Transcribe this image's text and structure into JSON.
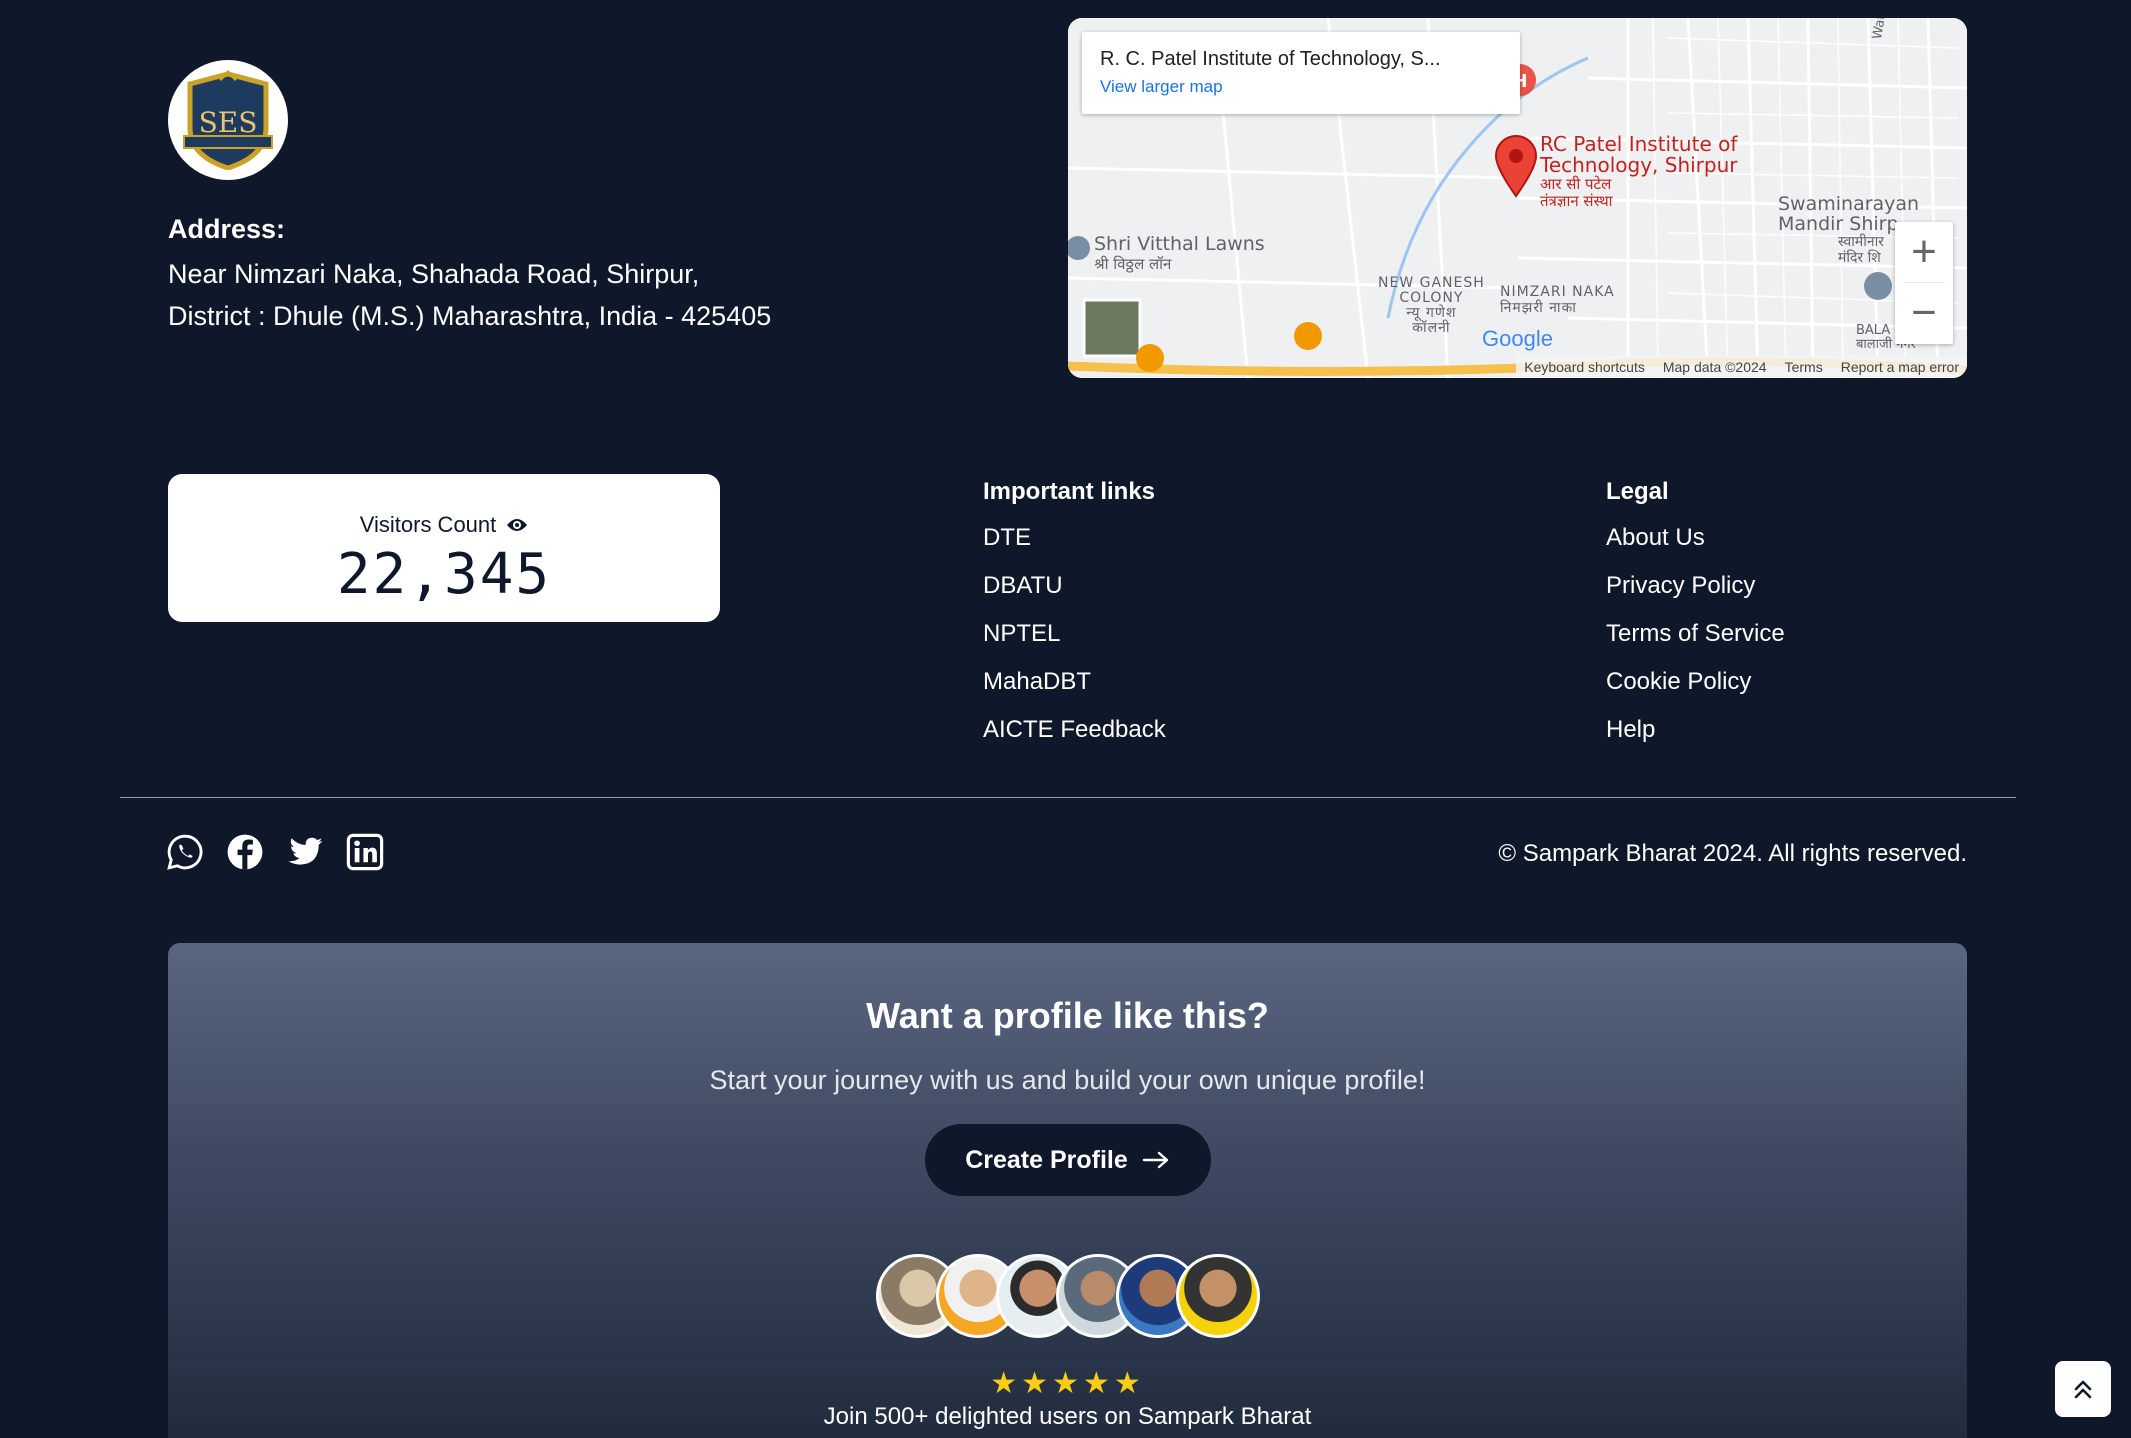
{
  "address": {
    "heading": "Address:",
    "line1": "Near Nimzari Naka, Shahada Road, Shirpur,",
    "line2": "District : Dhule (M.S.) Maharashtra, India - 425405"
  },
  "map": {
    "place_title": "R. C. Patel Institute of Technology, S...",
    "view_larger": "View larger map",
    "pin_label_line1": "RC Patel Institute of",
    "pin_label_line2": "Technology, Shirpur",
    "pin_label_hi1": "आर सी पटेल",
    "pin_label_hi2": "तंत्रज्ञान संस्था",
    "labels": {
      "vitthal": "Shri Vitthal Lawns",
      "vitthal_hi": "श्री विठ्ठल लॉन",
      "ganesh1": "NEW GANESH",
      "ganesh2": "COLONY",
      "ganesh_hi1": "न्यू गणेश",
      "ganesh_hi2": "कॉलनी",
      "nimzari": "NIMZARI NAKA",
      "nimzari_hi": "निमझरी नाका",
      "swami1": "Swaminarayan",
      "swami2": "Mandir Shirp",
      "swami_hi1": "स्वामीनार",
      "swami_hi2": "मंदिर शि",
      "water": "Water Tre",
      "bala": "BALA",
      "bala_hi": "बालाजी नगर",
      "google": "Google"
    },
    "zoom_in": "+",
    "zoom_out": "−",
    "footer": [
      "Keyboard shortcuts",
      "Map data ©2024",
      "Terms",
      "Report a map error"
    ]
  },
  "visitors": {
    "label": "Visitors Count",
    "count": "22,345"
  },
  "important_links": {
    "heading": "Important links",
    "items": [
      "DTE",
      "DBATU",
      "NPTEL",
      "MahaDBT",
      "AICTE Feedback"
    ]
  },
  "legal": {
    "heading": "Legal",
    "items": [
      "About Us",
      "Privacy Policy",
      "Terms of Service",
      "Cookie Policy",
      "Help"
    ]
  },
  "social": [
    "whatsapp-icon",
    "facebook-icon",
    "twitter-icon",
    "linkedin-icon"
  ],
  "copyright": "© Sampark Bharat 2024. All rights reserved.",
  "cta": {
    "title": "Want a profile like this?",
    "subtitle": "Start your journey with us and build your own unique profile!",
    "button": "Create Profile",
    "stars": "★★★★★",
    "join": "Join 500+ delighted users on Sampark Bharat"
  },
  "colors": {
    "background": "#0f172a",
    "card": "#ffffff",
    "star": "#facc15",
    "map_pin": "#ea4335"
  }
}
